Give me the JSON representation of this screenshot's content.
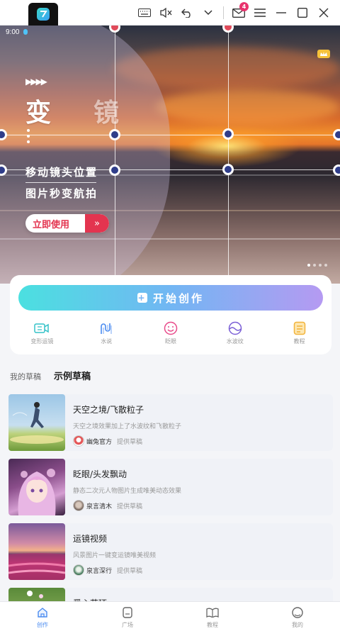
{
  "titlebar": {
    "app_icon": "app-logo-icon",
    "icons": [
      "keyboard-icon",
      "mute-icon",
      "undo-icon",
      "chevron-down-icon",
      "mail-icon",
      "menu-icon",
      "minimize-icon",
      "maximize-icon",
      "close-icon"
    ],
    "mail_badge": "4"
  },
  "status": {
    "time": "9:00"
  },
  "banner": {
    "arrows": "▶▶▶▶",
    "title_char1": "变",
    "title_char2": "镜",
    "line1": "移动镜头位置",
    "line2": "图片秒变航拍",
    "cta_label": "立即使用",
    "cta_arrow": "»"
  },
  "create": {
    "button_label": "开始创作",
    "tools": [
      {
        "label": "变形运镜",
        "icon": "camera-move-icon",
        "color": "#34c2c8"
      },
      {
        "label": "水说",
        "icon": "water-wave-icon",
        "color": "#4a8bf0"
      },
      {
        "label": "眨眼",
        "icon": "smile-icon",
        "color": "#e84a8a"
      },
      {
        "label": "水波纹",
        "icon": "ripple-icon",
        "color": "#7b5fd6"
      },
      {
        "label": "教程",
        "icon": "tutorial-icon",
        "color": "#f2b33a"
      }
    ]
  },
  "tabs": {
    "mine": "我的草稿",
    "examples": "示例草稿"
  },
  "drafts": [
    {
      "title": "天空之境/飞散粒子",
      "desc": "天空之境效果加上了水波纹和飞散粒子",
      "author": "幽兔官方",
      "note": "提供草稿"
    },
    {
      "title": "眨眼/头发飘动",
      "desc": "静态二次元人物图片生成唯美动态效果",
      "author": "泉言清木",
      "note": "提供草稿"
    },
    {
      "title": "运镜视频",
      "desc": "风景图片一键变运镜唯美视频",
      "author": "泉言深行",
      "note": "提供草稿"
    },
    {
      "title": "爱心花环",
      "desc": "",
      "author": "",
      "note": ""
    }
  ],
  "nav": {
    "items": [
      {
        "label": "创作",
        "icon": "home-icon"
      },
      {
        "label": "广场",
        "icon": "square-icon"
      },
      {
        "label": "教程",
        "icon": "book-icon"
      },
      {
        "label": "我的",
        "icon": "profile-icon"
      }
    ],
    "active_color": "#4a8bf0"
  }
}
